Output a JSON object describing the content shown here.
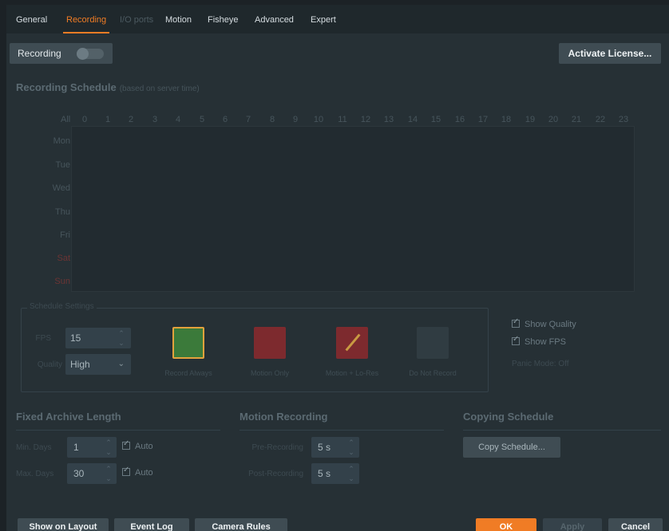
{
  "tabs": [
    {
      "label": "General",
      "state": "normal"
    },
    {
      "label": "Recording",
      "state": "active"
    },
    {
      "label": "I/O ports",
      "state": "disabled"
    },
    {
      "label": "Motion",
      "state": "normal"
    },
    {
      "label": "Fisheye",
      "state": "normal"
    },
    {
      "label": "Advanced",
      "state": "normal"
    },
    {
      "label": "Expert",
      "state": "normal"
    }
  ],
  "recording_toggle": {
    "label": "Recording",
    "enabled": false
  },
  "activate_license": "Activate License...",
  "schedule": {
    "title": "Recording Schedule",
    "hint": "(based on server time)",
    "all_label": "All",
    "hours": [
      "0",
      "1",
      "2",
      "3",
      "4",
      "5",
      "6",
      "7",
      "8",
      "9",
      "10",
      "11",
      "12",
      "13",
      "14",
      "15",
      "16",
      "17",
      "18",
      "19",
      "20",
      "21",
      "22",
      "23"
    ],
    "days": [
      "Mon",
      "Tue",
      "Wed",
      "Thu",
      "Fri",
      "Sat",
      "Sun"
    ]
  },
  "schedule_settings": {
    "legend": "Schedule Settings",
    "fps_label": "FPS",
    "fps_value": "15",
    "quality_label": "Quality",
    "quality_value": "High",
    "modes": [
      "Record Always",
      "Motion Only",
      "Motion + Lo-Res",
      "Do Not Record"
    ],
    "show_quality": "Show Quality",
    "show_fps": "Show FPS",
    "panic_mode": "Panic Mode: Off"
  },
  "archive": {
    "title": "Fixed Archive Length",
    "min_label": "Min. Days",
    "min_value": "1",
    "max_label": "Max. Days",
    "max_value": "30",
    "auto_label": "Auto"
  },
  "motion_recording": {
    "title": "Motion Recording",
    "pre_label": "Pre-Recording",
    "pre_value": "5 s",
    "post_label": "Post-Recording",
    "post_value": "5 s"
  },
  "copying": {
    "title": "Copying Schedule",
    "button": "Copy Schedule..."
  },
  "footer": {
    "show_on_layout": "Show on Layout",
    "event_log": "Event Log",
    "camera_rules": "Camera Rules",
    "ok": "OK",
    "apply": "Apply",
    "cancel": "Cancel"
  },
  "colors": {
    "accent": "#f07c25",
    "record_always": "#3b7a3a",
    "motion_only": "#7d2a2e"
  }
}
